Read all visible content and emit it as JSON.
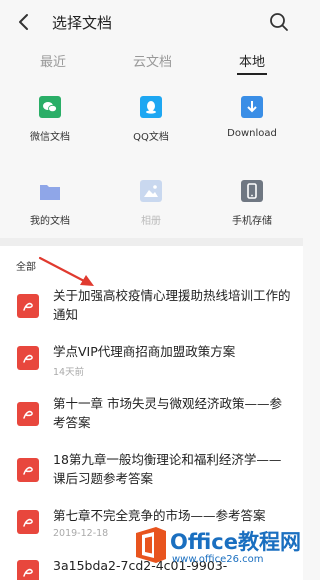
{
  "header": {
    "title": "选择文档"
  },
  "tabs": [
    {
      "label": "最近",
      "active": false
    },
    {
      "label": "云文档",
      "active": false
    },
    {
      "label": "本地",
      "active": true
    }
  ],
  "sources": [
    {
      "label": "微信文档",
      "icon": "wechat-icon",
      "color": "#2aae67"
    },
    {
      "label": "QQ文档",
      "icon": "qq-icon",
      "color": "#1ea7f2"
    },
    {
      "label": "Download",
      "icon": "download-icon",
      "color": "#3a8ee6"
    },
    {
      "label": "我的文档",
      "icon": "folder-icon",
      "color": "#8fa6e8"
    },
    {
      "label": "相册",
      "icon": "photo-icon",
      "color": "#c9d8ef",
      "disabled": true
    },
    {
      "label": "手机存储",
      "icon": "phone-icon",
      "color": "#6f7782"
    }
  ],
  "section_label": "全部",
  "files": [
    {
      "title": "关于加强高校疫情心理援助热线培训工作的通知",
      "date": ""
    },
    {
      "title": "学点VIP代理商招商加盟政策方案",
      "date": "14天前"
    },
    {
      "title": "第十一章 市场失灵与微观经济政策——参考答案",
      "date": ""
    },
    {
      "title": "18第九章一般均衡理论和福利经济学—— 课后习题参考答案",
      "date": ""
    },
    {
      "title": "第七章不完全竞争的市场——参考答案",
      "date": "2019-12-18"
    },
    {
      "title": "3a15bda2-7cd2-4c01-9903-",
      "date": ""
    }
  ],
  "watermark": {
    "brand": "Office教程网",
    "url": "www.office26.com"
  },
  "colors": {
    "file_icon": "#e8473d",
    "arrow": "#e03a2f",
    "watermark": "#1a6fc0"
  }
}
